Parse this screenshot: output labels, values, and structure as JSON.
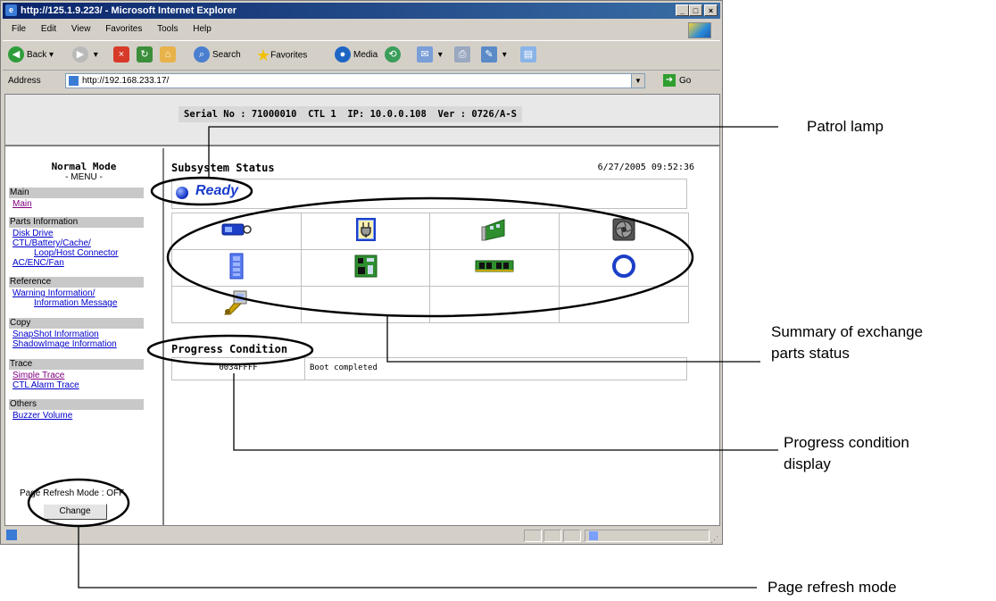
{
  "window": {
    "title": "http://125.1.9.223/ - Microsoft Internet Explorer",
    "controls": [
      "_",
      "□",
      "×"
    ]
  },
  "menubar": [
    "File",
    "Edit",
    "View",
    "Favorites",
    "Tools",
    "Help"
  ],
  "toolbar": {
    "back": "Back",
    "search": "Search",
    "favorites": "Favorites",
    "media": "Media"
  },
  "address": {
    "label": "Address",
    "url": "http://192.168.233.17/",
    "go": "Go"
  },
  "header": {
    "serial_info": "Serial No : 71000010  CTL 1  IP: 10.0.0.108  Ver : 0726/A-S"
  },
  "menu": {
    "mode_title": "Normal Mode",
    "menu_label": "- MENU -",
    "sections": [
      {
        "title": "Main",
        "links": [
          "Main"
        ]
      },
      {
        "title": "Parts Information",
        "links": [
          "Disk Drive",
          "CTL/Battery/Cache/",
          "Loop/Host Connector",
          "AC/ENC/Fan"
        ]
      },
      {
        "title": "Reference",
        "links": [
          "Warning Information/",
          "Information Message"
        ]
      },
      {
        "title": "Copy",
        "links": [
          "SnapShot Information",
          "ShadowImage Information"
        ]
      },
      {
        "title": "Trace",
        "links": [
          "Simple Trace",
          "CTL Alarm Trace"
        ]
      },
      {
        "title": "Others",
        "links": [
          "Buzzer Volume"
        ]
      }
    ],
    "refresh_mode": "Page Refresh Mode : OFF",
    "change_button": "Change"
  },
  "main": {
    "title": "Subsystem Status",
    "datetime": "6/27/2005 09:52:36",
    "status": "Ready",
    "progress_title": "Progress Condition",
    "progress_code": "0034FFFF",
    "progress_message": "Boot completed"
  },
  "parts_icons": [
    "battery-icon",
    "ac-power-icon",
    "controller-board-icon",
    "fan-icon",
    "enclosure-icon",
    "cache-board-icon",
    "cache-memory-icon",
    "loop-connector-icon",
    "host-connector-icon"
  ],
  "callouts": {
    "patrol_lamp": "Patrol lamp",
    "summary_line1": "Summary of exchange",
    "summary_line2": "parts status",
    "progress_line1": "Progress condition",
    "progress_line2": "display",
    "page_refresh": "Page refresh mode"
  }
}
